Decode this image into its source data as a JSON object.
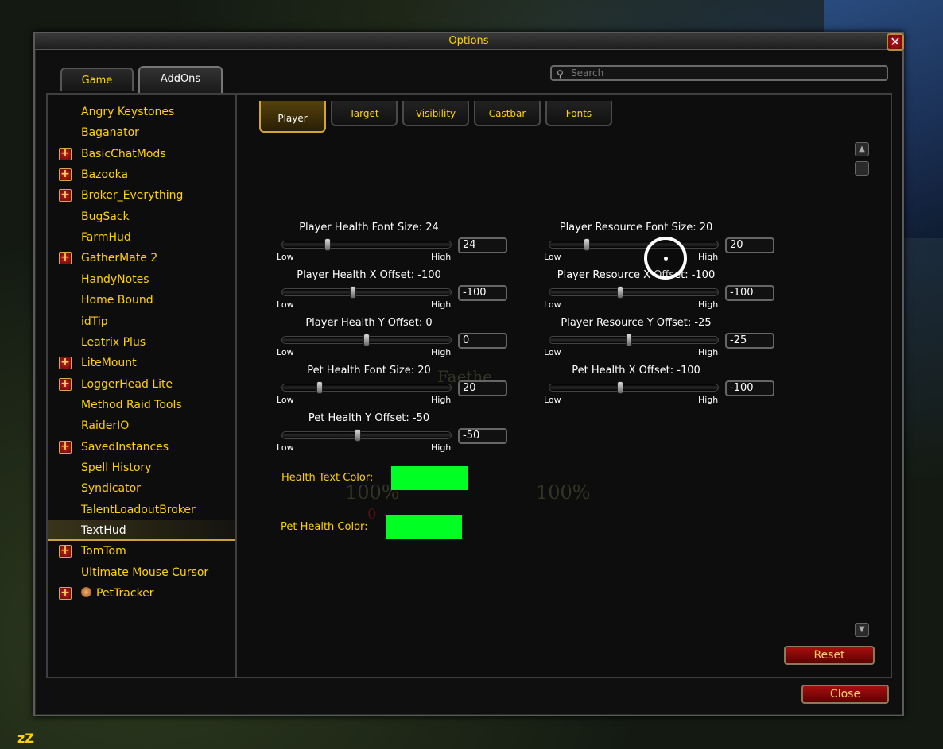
{
  "window": {
    "title": "Options",
    "close_glyph": "✕"
  },
  "top_tabs": [
    {
      "label": "Game"
    },
    {
      "label": "AddOns"
    }
  ],
  "search": {
    "placeholder": "Search",
    "icon": "search-icon"
  },
  "addons": [
    {
      "label": "Angry Keystones",
      "expandable": false
    },
    {
      "label": "Baganator",
      "expandable": false
    },
    {
      "label": "BasicChatMods",
      "expandable": true
    },
    {
      "label": "Bazooka",
      "expandable": true
    },
    {
      "label": "Broker_Everything",
      "expandable": true
    },
    {
      "label": "BugSack",
      "expandable": false
    },
    {
      "label": "FarmHud",
      "expandable": false
    },
    {
      "label": "GatherMate 2",
      "expandable": true
    },
    {
      "label": "HandyNotes",
      "expandable": false
    },
    {
      "label": "Home Bound",
      "expandable": false
    },
    {
      "label": "idTip",
      "expandable": false
    },
    {
      "label": "Leatrix Plus",
      "expandable": false
    },
    {
      "label": "LiteMount",
      "expandable": true
    },
    {
      "label": "LoggerHead Lite",
      "expandable": true
    },
    {
      "label": "Method Raid Tools",
      "expandable": false
    },
    {
      "label": "RaiderIO",
      "expandable": false
    },
    {
      "label": "SavedInstances",
      "expandable": true
    },
    {
      "label": "Spell History",
      "expandable": false
    },
    {
      "label": "Syndicator",
      "expandable": false
    },
    {
      "label": "TalentLoadoutBroker",
      "expandable": false
    },
    {
      "label": "TextHud",
      "expandable": false,
      "selected": true
    },
    {
      "label": "TomTom",
      "expandable": true
    },
    {
      "label": "Ultimate Mouse Cursor",
      "expandable": false
    },
    {
      "label": "PetTracker",
      "expandable": true,
      "icon": "pet-paw-icon"
    }
  ],
  "sub_tabs": [
    {
      "label": "Player",
      "active": true
    },
    {
      "label": "Target"
    },
    {
      "label": "Visibility"
    },
    {
      "label": "Castbar"
    },
    {
      "label": "Fonts"
    }
  ],
  "sliders": [
    {
      "label": "Player Health Font Size: 24",
      "value": "24",
      "low": "Low",
      "high": "High",
      "position": 0.27
    },
    {
      "label": "Player Resource Font Size: 20",
      "value": "20",
      "low": "Low",
      "high": "High",
      "position": 0.22
    },
    {
      "label": "Player Health X Offset: -100",
      "value": "-100",
      "low": "Low",
      "high": "High",
      "position": 0.42
    },
    {
      "label": "Player Resource X Offset: -100",
      "value": "-100",
      "low": "Low",
      "high": "High",
      "position": 0.42
    },
    {
      "label": "Player Health Y Offset: 0",
      "value": "0",
      "low": "Low",
      "high": "High",
      "position": 0.5
    },
    {
      "label": "Player Resource Y Offset: -25",
      "value": "-25",
      "low": "Low",
      "high": "High",
      "position": 0.47
    },
    {
      "label": "Pet Health Font Size: 20",
      "value": "20",
      "low": "Low",
      "high": "High",
      "position": 0.22
    },
    {
      "label": "Pet Health X Offset: -100",
      "value": "-100",
      "low": "Low",
      "high": "High",
      "position": 0.42
    },
    {
      "label": "Pet Health Y Offset: -50",
      "value": "-50",
      "low": "Low",
      "high": "High",
      "position": 0.45
    }
  ],
  "colors": [
    {
      "label": "Health Text Color:",
      "swatch": "#00ff22"
    },
    {
      "label": "Pet Health Color:",
      "swatch": "#00ff22"
    }
  ],
  "background_text": {
    "name": "Faethe",
    "left_health": "100%",
    "right_health": "100%",
    "zero": "0"
  },
  "buttons": {
    "reset": "Reset",
    "close": "Close"
  },
  "status": {
    "afk": "zZ"
  },
  "theme": {
    "gold": "#ffd200",
    "red_button": "#a80d0d"
  }
}
